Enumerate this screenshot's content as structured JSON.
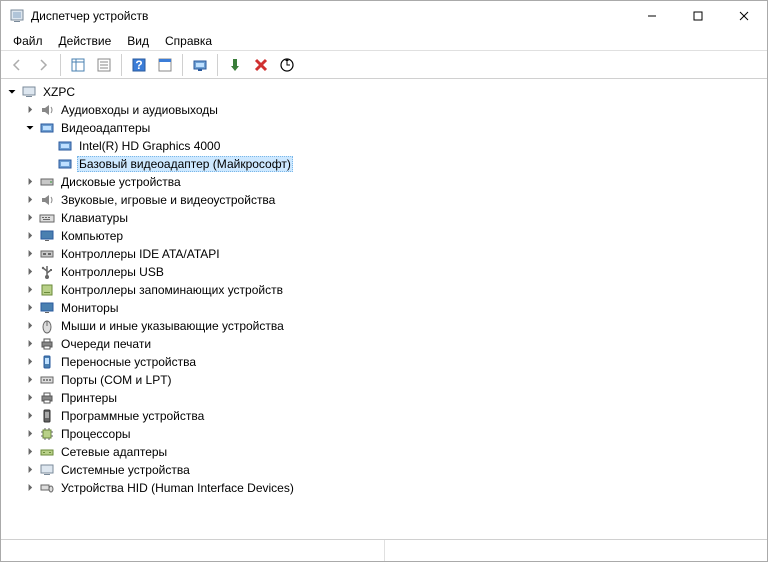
{
  "window": {
    "title": "Диспетчер устройств"
  },
  "menu": {
    "file": "Файл",
    "action": "Действие",
    "view": "Вид",
    "help": "Справка"
  },
  "tree": {
    "root": "XZPC",
    "cat": {
      "audio": "Аудиовходы и аудиовыходы",
      "video": "Видеоадаптеры",
      "video_c1": "Intel(R) HD Graphics 4000",
      "video_c2": "Базовый видеоадаптер (Майкрософт)",
      "disk": "Дисковые устройства",
      "sound": "Звуковые, игровые и видеоустройства",
      "keyboard": "Клавиатуры",
      "computer": "Компьютер",
      "ide": "Контроллеры IDE ATA/ATAPI",
      "usb": "Контроллеры USB",
      "storage": "Контроллеры запоминающих устройств",
      "monitor": "Мониторы",
      "mouse": "Мыши и иные указывающие устройства",
      "print_queue": "Очереди печати",
      "portable": "Переносные устройства",
      "ports": "Порты (COM и LPT)",
      "printers": "Принтеры",
      "software": "Программные устройства",
      "cpu": "Процессоры",
      "network": "Сетевые адаптеры",
      "system": "Системные устройства",
      "hid": "Устройства HID (Human Interface Devices)"
    }
  }
}
